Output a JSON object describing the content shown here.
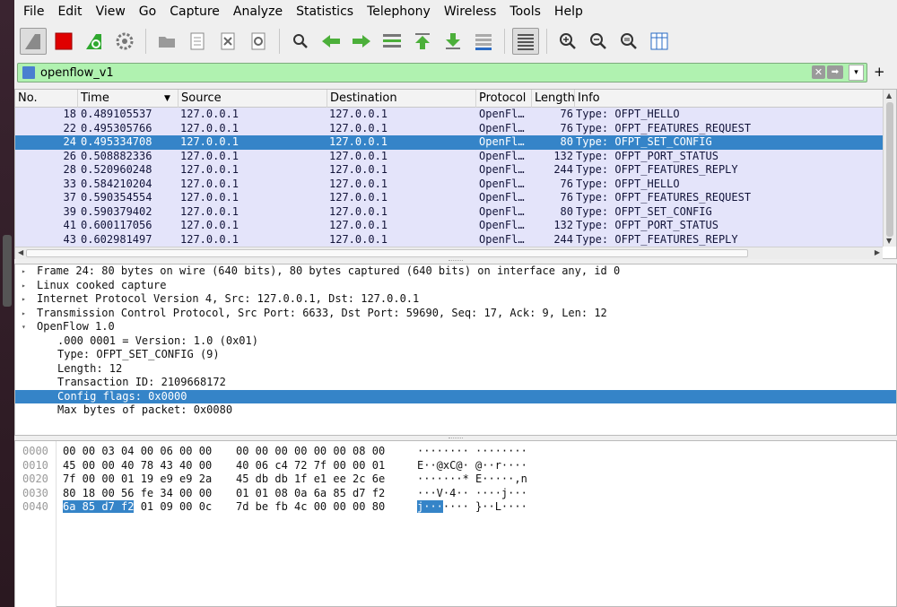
{
  "menubar": {
    "items": [
      "File",
      "Edit",
      "View",
      "Go",
      "Capture",
      "Analyze",
      "Statistics",
      "Telephony",
      "Wireless",
      "Tools",
      "Help"
    ]
  },
  "filter": {
    "value": "openflow_v1",
    "clear_label": "✕",
    "apply_label": "➡",
    "plus_label": "+"
  },
  "packet_list": {
    "columns": [
      "No.",
      "Time",
      "Source",
      "Destination",
      "Protocol",
      "Length",
      "Info"
    ],
    "rows": [
      {
        "no": "18",
        "time": "0.489105537",
        "source": "127.0.0.1",
        "destination": "127.0.0.1",
        "protocol": "OpenFl…",
        "length": "76",
        "info": "Type: OFPT_HELLO",
        "selected": false
      },
      {
        "no": "22",
        "time": "0.495305766",
        "source": "127.0.0.1",
        "destination": "127.0.0.1",
        "protocol": "OpenFl…",
        "length": "76",
        "info": "Type: OFPT_FEATURES_REQUEST",
        "selected": false
      },
      {
        "no": "24",
        "time": "0.495334708",
        "source": "127.0.0.1",
        "destination": "127.0.0.1",
        "protocol": "OpenFl…",
        "length": "80",
        "info": "Type: OFPT_SET_CONFIG",
        "selected": true
      },
      {
        "no": "26",
        "time": "0.508882336",
        "source": "127.0.0.1",
        "destination": "127.0.0.1",
        "protocol": "OpenFl…",
        "length": "132",
        "info": "Type: OFPT_PORT_STATUS",
        "selected": false
      },
      {
        "no": "28",
        "time": "0.520960248",
        "source": "127.0.0.1",
        "destination": "127.0.0.1",
        "protocol": "OpenFl…",
        "length": "244",
        "info": "Type: OFPT_FEATURES_REPLY",
        "selected": false
      },
      {
        "no": "33",
        "time": "0.584210204",
        "source": "127.0.0.1",
        "destination": "127.0.0.1",
        "protocol": "OpenFl…",
        "length": "76",
        "info": "Type: OFPT_HELLO",
        "selected": false
      },
      {
        "no": "37",
        "time": "0.590354554",
        "source": "127.0.0.1",
        "destination": "127.0.0.1",
        "protocol": "OpenFl…",
        "length": "76",
        "info": "Type: OFPT_FEATURES_REQUEST",
        "selected": false
      },
      {
        "no": "39",
        "time": "0.590379402",
        "source": "127.0.0.1",
        "destination": "127.0.0.1",
        "protocol": "OpenFl…",
        "length": "80",
        "info": "Type: OFPT_SET_CONFIG",
        "selected": false
      },
      {
        "no": "41",
        "time": "0.600117056",
        "source": "127.0.0.1",
        "destination": "127.0.0.1",
        "protocol": "OpenFl…",
        "length": "132",
        "info": "Type: OFPT_PORT_STATUS",
        "selected": false
      },
      {
        "no": "43",
        "time": "0.602981497",
        "source": "127.0.0.1",
        "destination": "127.0.0.1",
        "protocol": "OpenFl…",
        "length": "244",
        "info": "Type: OFPT_FEATURES_REPLY",
        "selected": false
      }
    ]
  },
  "details": {
    "rows": [
      {
        "text": "Frame 24: 80 bytes on wire (640 bits), 80 bytes captured (640 bits) on interface any, id 0",
        "arrow": "▸",
        "depth": 0,
        "selected": false
      },
      {
        "text": "Linux cooked capture",
        "arrow": "▸",
        "depth": 0,
        "selected": false
      },
      {
        "text": "Internet Protocol Version 4, Src: 127.0.0.1, Dst: 127.0.0.1",
        "arrow": "▸",
        "depth": 0,
        "selected": false
      },
      {
        "text": "Transmission Control Protocol, Src Port: 6633, Dst Port: 59690, Seq: 17, Ack: 9, Len: 12",
        "arrow": "▸",
        "depth": 0,
        "selected": false
      },
      {
        "text": "OpenFlow 1.0",
        "arrow": "▾",
        "depth": 0,
        "selected": false
      },
      {
        "text": ".000 0001 = Version: 1.0 (0x01)",
        "arrow": "",
        "depth": 1,
        "selected": false
      },
      {
        "text": "Type: OFPT_SET_CONFIG (9)",
        "arrow": "",
        "depth": 1,
        "selected": false
      },
      {
        "text": "Length: 12",
        "arrow": "",
        "depth": 1,
        "selected": false
      },
      {
        "text": "Transaction ID: 2109668172",
        "arrow": "",
        "depth": 1,
        "selected": false
      },
      {
        "text": "Config flags: 0x0000",
        "arrow": "",
        "depth": 1,
        "selected": true
      },
      {
        "text": "Max bytes of packet: 0x0080",
        "arrow": "",
        "depth": 1,
        "selected": false
      }
    ]
  },
  "hex": {
    "rows": [
      {
        "offset": "0000",
        "bytes1": "00 00 03 04 00 06 00 00",
        "bytes2": "00 00 00 00 00 00 08 00",
        "ascii": "········ ········"
      },
      {
        "offset": "0010",
        "bytes1": "45 00 00 40 78 43 40 00",
        "bytes2": "40 06 c4 72 7f 00 00 01",
        "ascii": "E··@xC@· @··r····"
      },
      {
        "offset": "0020",
        "bytes1": "7f 00 00 01 19 e9 e9 2a",
        "bytes2": "45 db db 1f e1 ee 2c 6e",
        "ascii": "·······* E·····,n"
      },
      {
        "offset": "0030",
        "bytes1": "80 18 00 56 fe 34 00 00",
        "bytes2": "01 01 08 0a 6a 85 d7 f2",
        "ascii": "···V·4·· ····j···"
      },
      {
        "offset": "0040",
        "bytes1_hl": "6a 85 d7 f2",
        "bytes1_rest": " 01 09 00 0c",
        "bytes2": "7d be fb 4c 00 00 00 80",
        "ascii_hl": "j···",
        "ascii_rest": "···· }··L····"
      }
    ]
  },
  "colors": {
    "selection": "#3584c8",
    "row_bg": "#e4e4fa",
    "filter_valid": "#b0f2b0",
    "stop_button": "#e00000",
    "shark_fin": "#8a8a8a"
  },
  "toolbar_icons": [
    "shark-fin-start-icon",
    "stop-icon",
    "restart-icon",
    "options-gear-icon",
    "open-folder-icon",
    "save-file-icon",
    "close-file-icon",
    "reload-icon",
    "find-icon",
    "go-back-icon",
    "go-forward-icon",
    "go-to-packet-icon",
    "go-first-icon",
    "go-last-icon",
    "autoscroll-icon",
    "colorize-icon",
    "zoom-in-icon",
    "zoom-out-icon",
    "zoom-normal-icon",
    "resize-columns-icon"
  ]
}
